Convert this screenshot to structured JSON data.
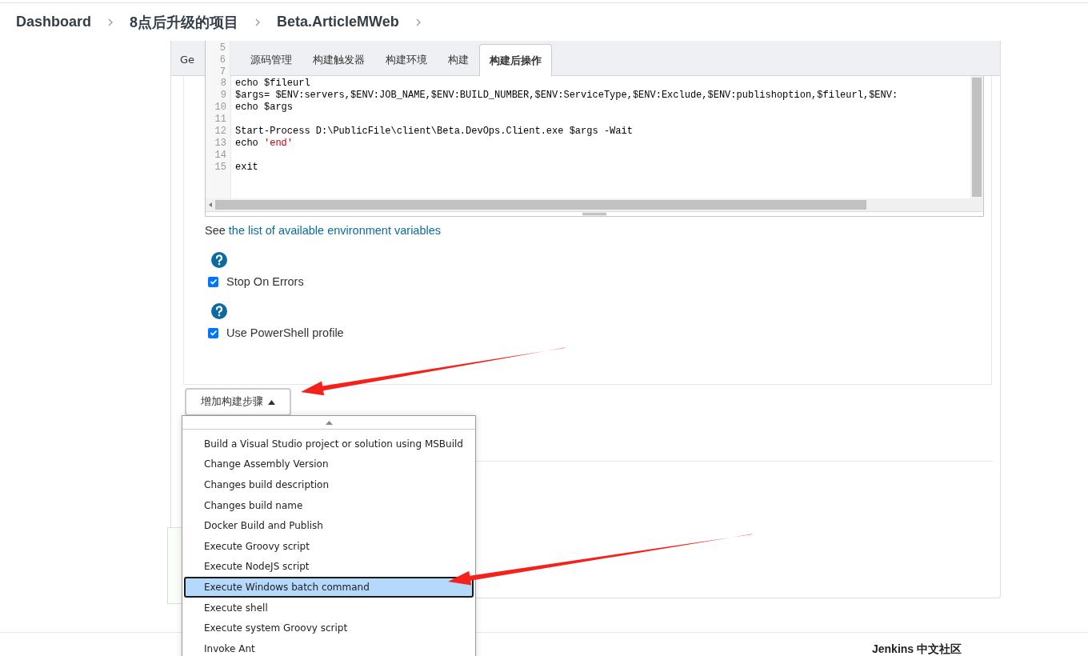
{
  "breadcrumbs": [
    "Dashboard",
    "8点后升级的项目",
    "Beta.ArticleMWeb"
  ],
  "tabs": [
    {
      "label": "Ge",
      "selected": false
    },
    {
      "label": "源码管理",
      "selected": false
    },
    {
      "label": "构建触发器",
      "selected": false
    },
    {
      "label": "构建环境",
      "selected": false
    },
    {
      "label": "构建",
      "selected": false
    },
    {
      "label": "构建后操作",
      "selected": true
    }
  ],
  "editor": {
    "lines": [
      {
        "number": "5"
      },
      {
        "number": "6"
      },
      {
        "number": "7"
      },
      {
        "number": "8",
        "segments": [
          {
            "kind": "plain",
            "text": "echo $fileurl"
          }
        ]
      },
      {
        "number": "9",
        "segments": [
          {
            "kind": "plain",
            "text": "$args= $ENV:servers,$ENV:JOB_NAME,$ENV:BUILD_NUMBER,$ENV:ServiceType,$ENV:Exclude,$ENV:publishoption,$fileurl,$ENV:"
          }
        ]
      },
      {
        "number": "10",
        "segments": [
          {
            "kind": "plain",
            "text": "echo $args"
          }
        ]
      },
      {
        "number": "11"
      },
      {
        "number": "12",
        "segments": [
          {
            "kind": "plain",
            "text": "Start-Process D:\\PublicFile\\client\\Beta.DevOps.Client.exe $args -Wait"
          }
        ]
      },
      {
        "number": "13",
        "segments": [
          {
            "kind": "plain",
            "text": "echo "
          },
          {
            "kind": "string",
            "text": "'end'"
          }
        ]
      },
      {
        "number": "14"
      },
      {
        "number": "15",
        "segments": [
          {
            "kind": "plain",
            "text": "exit"
          }
        ]
      }
    ]
  },
  "env_hint": {
    "prefix": "See",
    "link": "the list of available environment variables"
  },
  "options": [
    {
      "label": "Stop On Errors",
      "checked": true
    },
    {
      "label": "Use PowerShell profile",
      "checked": true
    }
  ],
  "add_step_button": {
    "label": "增加构建步骤",
    "expanded": true
  },
  "step_menu": [
    {
      "label": "Build a Visual Studio project or solution using MSBuild",
      "selected": false
    },
    {
      "label": "Change Assembly Version",
      "selected": false
    },
    {
      "label": "Changes build description",
      "selected": false
    },
    {
      "label": "Changes build name",
      "selected": false
    },
    {
      "label": "Docker Build and Publish",
      "selected": false
    },
    {
      "label": "Execute Groovy script",
      "selected": false
    },
    {
      "label": "Execute NodeJS script",
      "selected": false
    },
    {
      "label": "Execute Windows batch command",
      "selected": true
    },
    {
      "label": "Execute shell",
      "selected": false
    },
    {
      "label": "Execute system Groovy script",
      "selected": false
    },
    {
      "label": "Invoke Ant",
      "selected": false
    }
  ],
  "footer": {
    "links": [
      "Jenkins 中文社区"
    ]
  }
}
